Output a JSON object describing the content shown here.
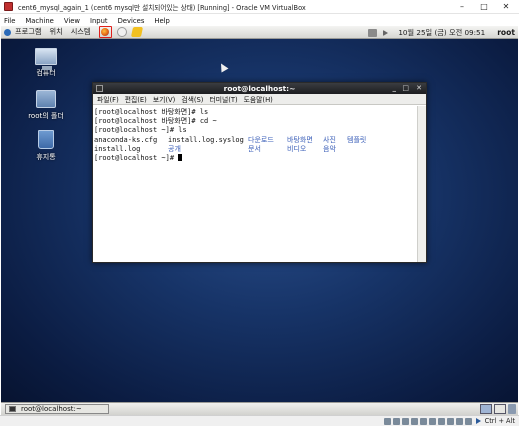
{
  "vbox": {
    "title": "cent6_mysql_again_1 (cent6 mysql만 설치되어있는 상태) [Running] - Oracle VM VirtualBox",
    "menu": [
      "File",
      "Machine",
      "View",
      "Input",
      "Devices",
      "Help"
    ],
    "status": {
      "host_key": "Ctrl + Alt"
    }
  },
  "guest": {
    "top_panel": {
      "menus": [
        "프로그램",
        "위치",
        "시스템"
      ],
      "launchers": [
        "firefox-icon",
        "mail-icon",
        "note-icon"
      ],
      "clock": "10월 25일 (금) 오전 09:51",
      "user": "root"
    },
    "desktop_icons": [
      {
        "label": "컴퓨터",
        "icon": "computer-icon"
      },
      {
        "label": "root의 폴더",
        "icon": "home-folder-icon"
      },
      {
        "label": "휴지통",
        "icon": "trash-icon"
      }
    ],
    "terminal": {
      "title": "root@localhost:~",
      "menus": [
        "파일(F)",
        "편집(E)",
        "보기(V)",
        "검색(S)",
        "터미널(T)",
        "도움말(H)"
      ],
      "lines": [
        "[root@localhost 바탕화면]# ls",
        "[root@localhost 바탕화면]# cd ~",
        "[root@localhost ~]# ls"
      ],
      "ls_output": {
        "row1": [
          "anaconda-ks.cfg",
          "install.log.syslog",
          "다운로드",
          "바탕화면",
          "사진",
          "템플릿"
        ],
        "row2": [
          "install.log",
          "공개",
          "문서",
          "비디오",
          "음악"
        ]
      },
      "prompt": "[root@localhost ~]# "
    },
    "bottom_panel": {
      "task_label": "root@localhost:~"
    }
  },
  "colors": {
    "desktop": "#173468",
    "directory_text": "#3b5fb8",
    "firefox_highlight": "#e0201c"
  }
}
